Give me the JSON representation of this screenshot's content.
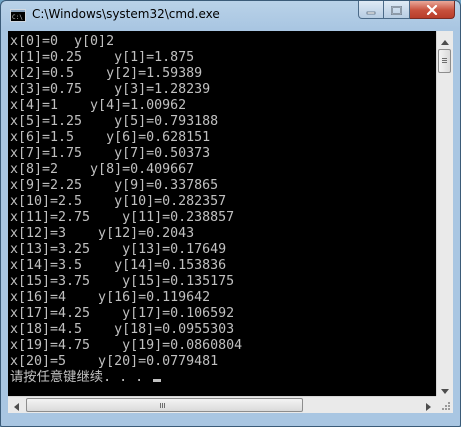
{
  "window": {
    "title": "C:\\Windows\\system32\\cmd.exe"
  },
  "caption_buttons": {
    "minimize_icon": "minimize-icon",
    "maximize_icon": "maximize-icon",
    "close_icon": "close-icon"
  },
  "console": {
    "lines": [
      "x[0]=0  y[0]2",
      "x[1]=0.25    y[1]=1.875",
      "x[2]=0.5    y[2]=1.59389",
      "x[3]=0.75    y[3]=1.28239",
      "x[4]=1    y[4]=1.00962",
      "x[5]=1.25    y[5]=0.793188",
      "x[6]=1.5    y[6]=0.628151",
      "x[7]=1.75    y[7]=0.50373",
      "x[8]=2    y[8]=0.409667",
      "x[9]=2.25    y[9]=0.337865",
      "x[10]=2.5    y[10]=0.282357",
      "x[11]=2.75    y[11]=0.238857",
      "x[12]=3    y[12]=0.2043",
      "x[13]=3.25    y[13]=0.17649",
      "x[14]=3.5    y[14]=0.153836",
      "x[15]=3.75    y[15]=0.135175",
      "x[16]=4    y[16]=0.119642",
      "x[17]=4.25    y[17]=0.106592",
      "x[18]=4.5    y[18]=0.0955303",
      "x[19]=4.75    y[19]=0.0860804",
      "x[20]=5    y[20]=0.0779481"
    ],
    "prompt": "请按任意键继续. . . "
  },
  "colors": {
    "console_background": "#000000",
    "console_text": "#c0c0c0",
    "close_button": "#c7503c"
  }
}
